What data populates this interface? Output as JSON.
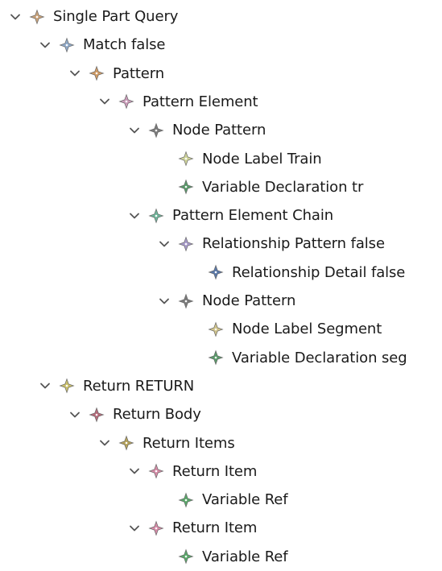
{
  "nodes": [
    {
      "label": "Single Part Query",
      "depth": 0,
      "expanded": true,
      "icon": "diamond-node-icon",
      "color": "#c9a27a"
    },
    {
      "label": "Match false",
      "depth": 1,
      "expanded": true,
      "icon": "diamond-node-icon",
      "color": "#8fa9c8"
    },
    {
      "label": "Pattern",
      "depth": 2,
      "expanded": true,
      "icon": "diamond-node-icon",
      "color": "#cf9a63"
    },
    {
      "label": "Pattern Element",
      "depth": 3,
      "expanded": true,
      "icon": "diamond-node-icon",
      "color": "#c99ab8"
    },
    {
      "label": "Node Pattern",
      "depth": 4,
      "expanded": true,
      "icon": "diamond-node-icon",
      "color": "#7a7a7a"
    },
    {
      "label": "Node Label Train",
      "depth": 5,
      "expanded": false,
      "icon": "diamond-node-icon",
      "color": "#cfd49a"
    },
    {
      "label": "Variable Declaration tr",
      "depth": 5,
      "expanded": false,
      "icon": "diamond-node-icon",
      "color": "#5a9a6a"
    },
    {
      "label": "Pattern Element Chain",
      "depth": 4,
      "expanded": true,
      "icon": "diamond-node-icon",
      "color": "#6fb59a"
    },
    {
      "label": "Relationship Pattern false",
      "depth": 5,
      "expanded": true,
      "icon": "diamond-node-icon",
      "color": "#a79ac9"
    },
    {
      "label": "Relationship Detail false",
      "depth": 6,
      "expanded": false,
      "icon": "diamond-node-icon",
      "color": "#5a78a8"
    },
    {
      "label": "Node Pattern",
      "depth": 5,
      "expanded": true,
      "icon": "diamond-node-icon",
      "color": "#7a7a7a"
    },
    {
      "label": "Node Label Segment",
      "depth": 6,
      "expanded": false,
      "icon": "diamond-node-icon",
      "color": "#cfc38a"
    },
    {
      "label": "Variable Declaration seg",
      "depth": 6,
      "expanded": false,
      "icon": "diamond-node-icon",
      "color": "#5a9a6a"
    },
    {
      "label": "Return RETURN",
      "depth": 1,
      "expanded": true,
      "icon": "diamond-node-icon",
      "color": "#c9bf6a"
    },
    {
      "label": "Return Body",
      "depth": 2,
      "expanded": true,
      "icon": "diamond-node-icon",
      "color": "#b56a7a"
    },
    {
      "label": "Return Items",
      "depth": 3,
      "expanded": true,
      "icon": "diamond-node-icon",
      "color": "#b5a25a"
    },
    {
      "label": "Return Item",
      "depth": 4,
      "expanded": true,
      "icon": "diamond-node-icon",
      "color": "#d48aa6"
    },
    {
      "label": "Variable Ref",
      "depth": 5,
      "expanded": false,
      "icon": "diamond-node-icon",
      "color": "#5aa86a"
    },
    {
      "label": "Return Item",
      "depth": 4,
      "expanded": true,
      "icon": "diamond-node-icon",
      "color": "#d48aa6"
    },
    {
      "label": "Variable Ref",
      "depth": 5,
      "expanded": false,
      "icon": "diamond-node-icon",
      "color": "#5aa86a"
    }
  ]
}
